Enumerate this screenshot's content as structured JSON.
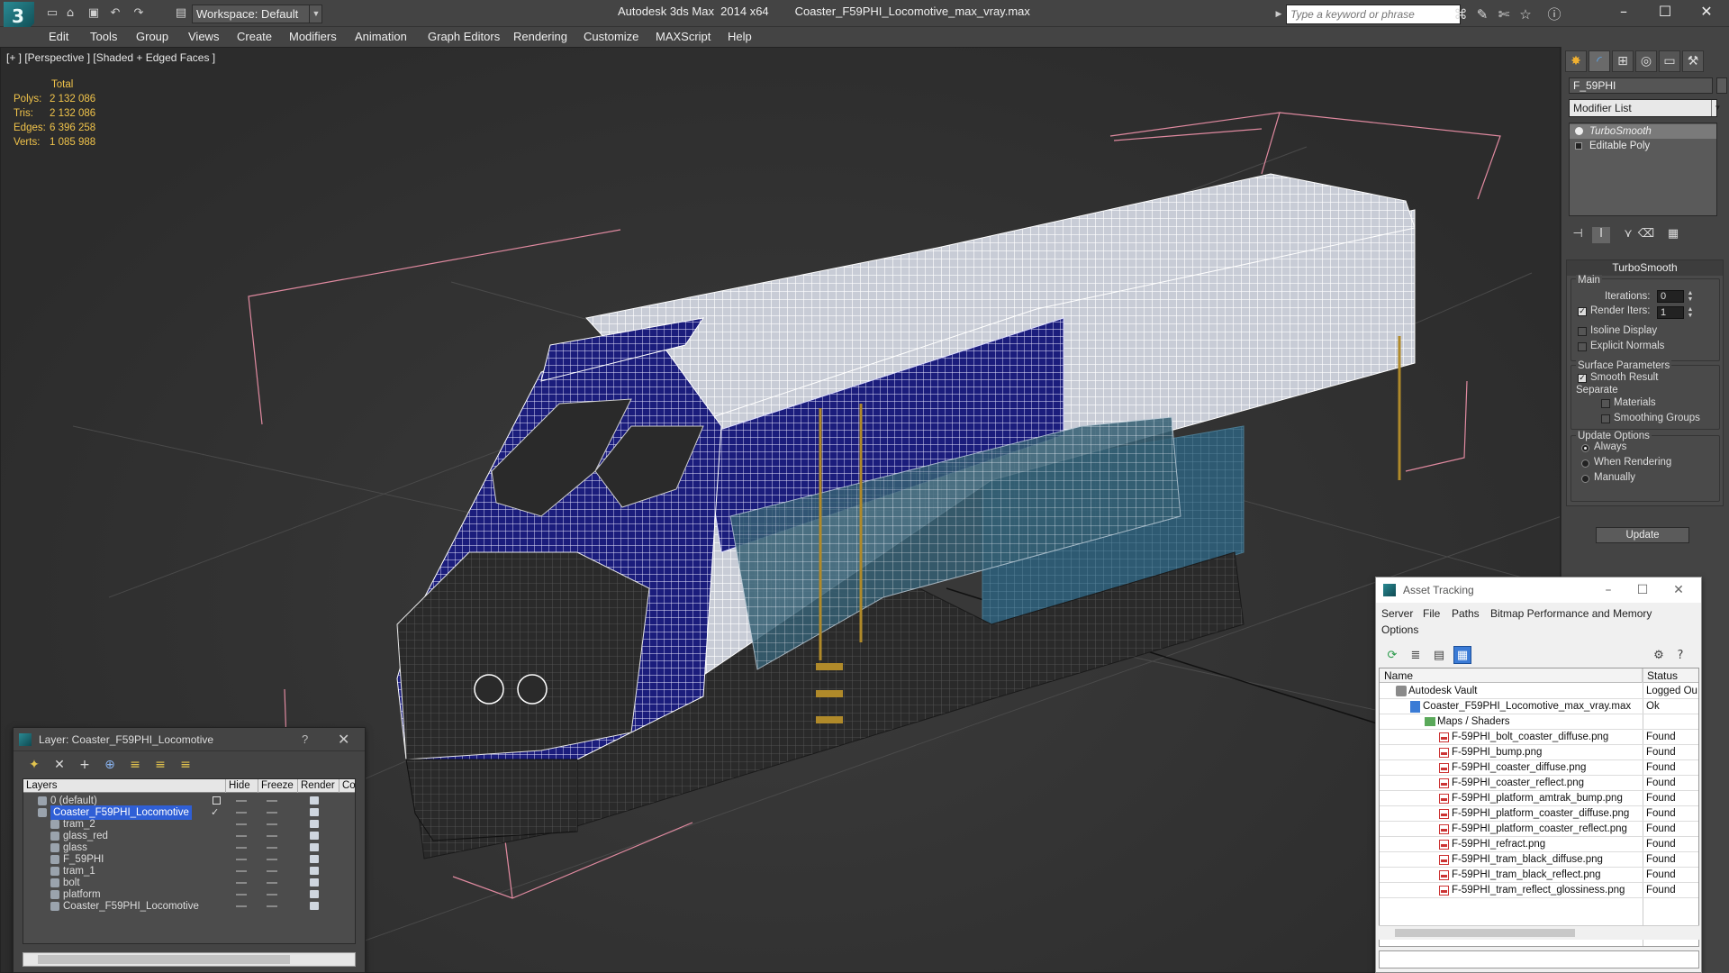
{
  "titlebar": {
    "workspace_label": "Workspace: Default",
    "app_name": "Autodesk 3ds Max  2014 x64",
    "file_name": "Coaster_F59PHI_Locomotive_max_vray.max",
    "search_placeholder": "Type a keyword or phrase"
  },
  "menu": [
    "Edit",
    "Tools",
    "Group",
    "Views",
    "Create",
    "Modifiers",
    "Animation",
    "Graph Editors",
    "Rendering",
    "Customize",
    "MAXScript",
    "Help"
  ],
  "viewport": {
    "label": "[+ ] [Perspective ] [Shaded + Edged Faces ]",
    "stats": {
      "total": "Total",
      "polys_label": "Polys:",
      "polys": "2 132 086",
      "tris_label": "Tris:",
      "tris": "2 132 086",
      "edges_label": "Edges:",
      "edges": "6 396 258",
      "verts_label": "Verts:",
      "verts": "1 085 988"
    }
  },
  "command_panel": {
    "object_name": "F_59PHI",
    "modifier_list": "Modifier List",
    "stack": [
      "TurboSmooth",
      "Editable Poly"
    ],
    "rollout_title": "TurboSmooth",
    "main_label": "Main",
    "iterations_label": "Iterations:",
    "iterations_value": "0",
    "render_iters_label": "Render Iters:",
    "render_iters_value": "1",
    "isoline_label": "Isoline Display",
    "explicit_normals_label": "Explicit Normals",
    "surface_params_label": "Surface Parameters",
    "smooth_result_label": "Smooth Result",
    "separate_label": "Separate",
    "materials_label": "Materials",
    "smoothing_groups_label": "Smoothing Groups",
    "update_options_label": "Update Options",
    "always_label": "Always",
    "when_rendering_label": "When Rendering",
    "manually_label": "Manually",
    "update_button": "Update"
  },
  "layer_explorer": {
    "title": "Layer: Coaster_F59PHI_Locomotive",
    "help": "?",
    "columns": [
      "Layers",
      "Hide",
      "Freeze",
      "Render",
      "Co"
    ],
    "rows": [
      {
        "name": "0 (default)"
      },
      {
        "name": "Coaster_F59PHI_Locomotive"
      },
      {
        "name": "tram_2"
      },
      {
        "name": "glass_red"
      },
      {
        "name": "glass"
      },
      {
        "name": "F_59PHI"
      },
      {
        "name": "tram_1"
      },
      {
        "name": "bolt"
      },
      {
        "name": "platform"
      },
      {
        "name": "Coaster_F59PHI_Locomotive"
      }
    ]
  },
  "asset_tracking": {
    "title": "Asset Tracking",
    "menu": [
      "Server",
      "File",
      "Paths",
      "Bitmap Performance and Memory",
      "Options"
    ],
    "columns": [
      "Name",
      "Status"
    ],
    "rows": [
      {
        "name": "Autodesk Vault",
        "status": "Logged Ou"
      },
      {
        "name": "Coaster_F59PHI_Locomotive_max_vray.max",
        "status": "Ok"
      },
      {
        "name": "Maps / Shaders",
        "status": ""
      },
      {
        "name": "F-59PHI_bolt_coaster_diffuse.png",
        "status": "Found"
      },
      {
        "name": "F-59PHI_bump.png",
        "status": "Found"
      },
      {
        "name": "F-59PHI_coaster_diffuse.png",
        "status": "Found"
      },
      {
        "name": "F-59PHI_coaster_reflect.png",
        "status": "Found"
      },
      {
        "name": "F-59PHI_platform_amtrak_bump.png",
        "status": "Found"
      },
      {
        "name": "F-59PHI_platform_coaster_diffuse.png",
        "status": "Found"
      },
      {
        "name": "F-59PHI_platform_coaster_reflect.png",
        "status": "Found"
      },
      {
        "name": "F-59PHI_refract.png",
        "status": "Found"
      },
      {
        "name": "F-59PHI_tram_black_diffuse.png",
        "status": "Found"
      },
      {
        "name": "F-59PHI_tram_black_reflect.png",
        "status": "Found"
      },
      {
        "name": "F-59PHI_tram_reflect_glossiness.png",
        "status": "Found"
      }
    ]
  },
  "colors": {
    "stats_text": "#f0c34a",
    "selection_blue": "#2f5fd6",
    "wire_white": "#ffffff",
    "wire_navy": "#1a1a7a",
    "bbox_pink": "#e08aa0"
  }
}
